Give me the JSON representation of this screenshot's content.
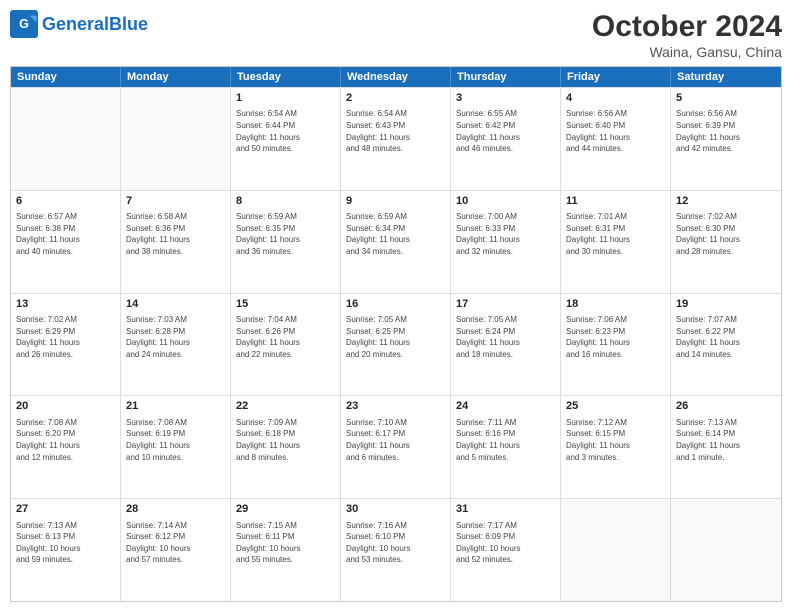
{
  "header": {
    "logo_general": "General",
    "logo_blue": "Blue",
    "month": "October 2024",
    "location": "Waina, Gansu, China"
  },
  "weekdays": [
    "Sunday",
    "Monday",
    "Tuesday",
    "Wednesday",
    "Thursday",
    "Friday",
    "Saturday"
  ],
  "rows": [
    [
      {
        "day": "",
        "lines": []
      },
      {
        "day": "",
        "lines": []
      },
      {
        "day": "1",
        "lines": [
          "Sunrise: 6:54 AM",
          "Sunset: 6:44 PM",
          "Daylight: 11 hours",
          "and 50 minutes."
        ]
      },
      {
        "day": "2",
        "lines": [
          "Sunrise: 6:54 AM",
          "Sunset: 6:43 PM",
          "Daylight: 11 hours",
          "and 48 minutes."
        ]
      },
      {
        "day": "3",
        "lines": [
          "Sunrise: 6:55 AM",
          "Sunset: 6:42 PM",
          "Daylight: 11 hours",
          "and 46 minutes."
        ]
      },
      {
        "day": "4",
        "lines": [
          "Sunrise: 6:56 AM",
          "Sunset: 6:40 PM",
          "Daylight: 11 hours",
          "and 44 minutes."
        ]
      },
      {
        "day": "5",
        "lines": [
          "Sunrise: 6:56 AM",
          "Sunset: 6:39 PM",
          "Daylight: 11 hours",
          "and 42 minutes."
        ]
      }
    ],
    [
      {
        "day": "6",
        "lines": [
          "Sunrise: 6:57 AM",
          "Sunset: 6:38 PM",
          "Daylight: 11 hours",
          "and 40 minutes."
        ]
      },
      {
        "day": "7",
        "lines": [
          "Sunrise: 6:58 AM",
          "Sunset: 6:36 PM",
          "Daylight: 11 hours",
          "and 38 minutes."
        ]
      },
      {
        "day": "8",
        "lines": [
          "Sunrise: 6:59 AM",
          "Sunset: 6:35 PM",
          "Daylight: 11 hours",
          "and 36 minutes."
        ]
      },
      {
        "day": "9",
        "lines": [
          "Sunrise: 6:59 AM",
          "Sunset: 6:34 PM",
          "Daylight: 11 hours",
          "and 34 minutes."
        ]
      },
      {
        "day": "10",
        "lines": [
          "Sunrise: 7:00 AM",
          "Sunset: 6:33 PM",
          "Daylight: 11 hours",
          "and 32 minutes."
        ]
      },
      {
        "day": "11",
        "lines": [
          "Sunrise: 7:01 AM",
          "Sunset: 6:31 PM",
          "Daylight: 11 hours",
          "and 30 minutes."
        ]
      },
      {
        "day": "12",
        "lines": [
          "Sunrise: 7:02 AM",
          "Sunset: 6:30 PM",
          "Daylight: 11 hours",
          "and 28 minutes."
        ]
      }
    ],
    [
      {
        "day": "13",
        "lines": [
          "Sunrise: 7:02 AM",
          "Sunset: 6:29 PM",
          "Daylight: 11 hours",
          "and 26 minutes."
        ]
      },
      {
        "day": "14",
        "lines": [
          "Sunrise: 7:03 AM",
          "Sunset: 6:28 PM",
          "Daylight: 11 hours",
          "and 24 minutes."
        ]
      },
      {
        "day": "15",
        "lines": [
          "Sunrise: 7:04 AM",
          "Sunset: 6:26 PM",
          "Daylight: 11 hours",
          "and 22 minutes."
        ]
      },
      {
        "day": "16",
        "lines": [
          "Sunrise: 7:05 AM",
          "Sunset: 6:25 PM",
          "Daylight: 11 hours",
          "and 20 minutes."
        ]
      },
      {
        "day": "17",
        "lines": [
          "Sunrise: 7:05 AM",
          "Sunset: 6:24 PM",
          "Daylight: 11 hours",
          "and 18 minutes."
        ]
      },
      {
        "day": "18",
        "lines": [
          "Sunrise: 7:06 AM",
          "Sunset: 6:23 PM",
          "Daylight: 11 hours",
          "and 16 minutes."
        ]
      },
      {
        "day": "19",
        "lines": [
          "Sunrise: 7:07 AM",
          "Sunset: 6:22 PM",
          "Daylight: 11 hours",
          "and 14 minutes."
        ]
      }
    ],
    [
      {
        "day": "20",
        "lines": [
          "Sunrise: 7:08 AM",
          "Sunset: 6:20 PM",
          "Daylight: 11 hours",
          "and 12 minutes."
        ]
      },
      {
        "day": "21",
        "lines": [
          "Sunrise: 7:08 AM",
          "Sunset: 6:19 PM",
          "Daylight: 11 hours",
          "and 10 minutes."
        ]
      },
      {
        "day": "22",
        "lines": [
          "Sunrise: 7:09 AM",
          "Sunset: 6:18 PM",
          "Daylight: 11 hours",
          "and 8 minutes."
        ]
      },
      {
        "day": "23",
        "lines": [
          "Sunrise: 7:10 AM",
          "Sunset: 6:17 PM",
          "Daylight: 11 hours",
          "and 6 minutes."
        ]
      },
      {
        "day": "24",
        "lines": [
          "Sunrise: 7:11 AM",
          "Sunset: 6:16 PM",
          "Daylight: 11 hours",
          "and 5 minutes."
        ]
      },
      {
        "day": "25",
        "lines": [
          "Sunrise: 7:12 AM",
          "Sunset: 6:15 PM",
          "Daylight: 11 hours",
          "and 3 minutes."
        ]
      },
      {
        "day": "26",
        "lines": [
          "Sunrise: 7:13 AM",
          "Sunset: 6:14 PM",
          "Daylight: 11 hours",
          "and 1 minute."
        ]
      }
    ],
    [
      {
        "day": "27",
        "lines": [
          "Sunrise: 7:13 AM",
          "Sunset: 6:13 PM",
          "Daylight: 10 hours",
          "and 59 minutes."
        ]
      },
      {
        "day": "28",
        "lines": [
          "Sunrise: 7:14 AM",
          "Sunset: 6:12 PM",
          "Daylight: 10 hours",
          "and 57 minutes."
        ]
      },
      {
        "day": "29",
        "lines": [
          "Sunrise: 7:15 AM",
          "Sunset: 6:11 PM",
          "Daylight: 10 hours",
          "and 55 minutes."
        ]
      },
      {
        "day": "30",
        "lines": [
          "Sunrise: 7:16 AM",
          "Sunset: 6:10 PM",
          "Daylight: 10 hours",
          "and 53 minutes."
        ]
      },
      {
        "day": "31",
        "lines": [
          "Sunrise: 7:17 AM",
          "Sunset: 6:09 PM",
          "Daylight: 10 hours",
          "and 52 minutes."
        ]
      },
      {
        "day": "",
        "lines": []
      },
      {
        "day": "",
        "lines": []
      }
    ]
  ]
}
